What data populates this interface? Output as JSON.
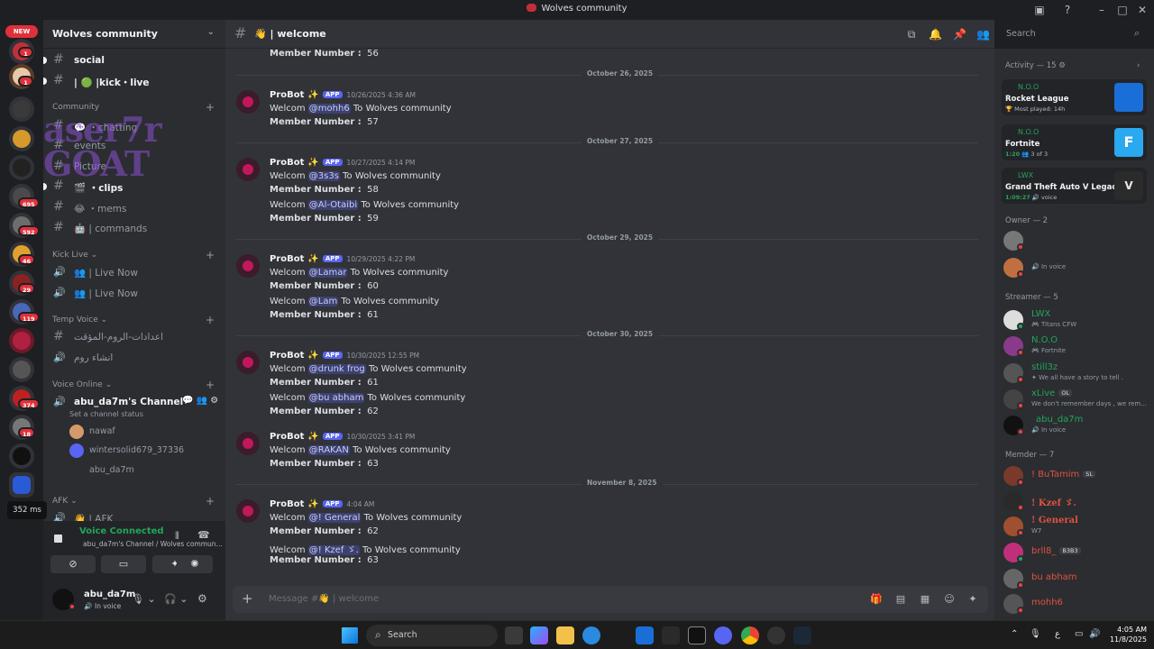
{
  "window": {
    "title": "Wolves community"
  },
  "servers": {
    "new_label": "NEW",
    "badges": [
      "1",
      "1",
      "695",
      "592",
      "46",
      "29",
      "119",
      "374",
      "18"
    ]
  },
  "guild": {
    "name": "Wolves community"
  },
  "channels": [
    {
      "label": "social",
      "unread": true
    },
    {
      "label": "| 🟢 |kick・live",
      "unread": true
    },
    {
      "label": "💬 ・chatting",
      "unread": false
    },
    {
      "label": "events",
      "unread": false
    },
    {
      "label": "Picture",
      "unread": false
    },
    {
      "label": "🎬 ・clips",
      "unread": true
    },
    {
      "label": "😂 ・mems",
      "unread": false
    },
    {
      "label": "🤖 | commands",
      "unread": false
    }
  ],
  "overlay_text": {
    "line1": "aser7r",
    "line2": "GOAT"
  },
  "categories": {
    "community": "Community",
    "kick_live": "Kick Live",
    "temp_voice": "Temp Voice",
    "voice_online": "Voice Online",
    "afk": "AFK"
  },
  "kick_live": [
    "👥 | Live Now",
    "👥 | Live Now"
  ],
  "temp_voice": [
    "اعدادات-الروم-المؤقت",
    "انشاء روم"
  ],
  "voice_channel": {
    "name": "abu_da7m's Channel",
    "status": "Set a channel status",
    "users": [
      "nawaf",
      "wintersolid679_37336",
      "abu_da7m"
    ]
  },
  "afk_channel": "👋 | AFK",
  "ping": "352 ms",
  "voice_panel": {
    "status": "Voice Connected",
    "location": "abu_da7m's Channel / Wolves commun..."
  },
  "user_panel": {
    "name": "abu_da7m",
    "status": "In voice"
  },
  "channel_header": {
    "name": "👋 | welcome",
    "search_placeholder": "Search"
  },
  "messages": {
    "top_line": {
      "label": "Member Number :",
      "value": "56"
    },
    "groups": [
      {
        "date": "October 26, 2025",
        "author": "ProBot",
        "badge": "APP",
        "time": "10/26/2025 4:36 AM",
        "entries": [
          {
            "mention": "@mohh6",
            "number": "57"
          }
        ]
      },
      {
        "date": "October 27, 2025",
        "author": "ProBot",
        "badge": "APP",
        "time": "10/27/2025 4:14 PM",
        "entries": [
          {
            "mention": "@3s3s",
            "number": "58"
          },
          {
            "mention": "@Al-Otaibi",
            "number": "59"
          }
        ]
      },
      {
        "date": "October 29, 2025",
        "author": "ProBot",
        "badge": "APP",
        "time": "10/29/2025 4:22 PM",
        "entries": [
          {
            "mention": "@Lamar",
            "number": "60"
          },
          {
            "mention": "@Lam",
            "number": "61"
          }
        ]
      },
      {
        "date": "October 30, 2025",
        "author": "ProBot",
        "badge": "APP",
        "time": "10/30/2025 12:55 PM",
        "entries": [
          {
            "mention": "@drunk frog",
            "number": "61"
          },
          {
            "mention": "@bu abham",
            "number": "62"
          }
        ]
      },
      {
        "date": "",
        "author": "ProBot",
        "badge": "APP",
        "time": "10/30/2025 3:41 PM",
        "entries": [
          {
            "mention": "@RAKAN",
            "number": "63"
          }
        ]
      },
      {
        "date": "November 8, 2025",
        "author": "ProBot",
        "badge": "APP",
        "time": "4:04 AM",
        "entries": [
          {
            "mention": "@! General",
            "number": "62"
          },
          {
            "mention": "@!  Kzef ゞ.",
            "number": "63"
          }
        ]
      }
    ],
    "welcome_word": "Welcom",
    "to_word": "To",
    "community": "Wolves community",
    "member_label": "Member Number :"
  },
  "composer": {
    "placeholder": "Message #👋 | welcome"
  },
  "activity": {
    "header": "Activity — 15",
    "cards": [
      {
        "user": "N.O.O",
        "game": "Rocket League",
        "detail": "Most played: 14h",
        "time": "",
        "extra": ""
      },
      {
        "user": "N.O.O",
        "game": "Fortnite",
        "detail": "",
        "time": "1:20",
        "extra": "3 of 3"
      },
      {
        "user": "LWX",
        "game": "Grand Theft Auto V Legacy",
        "detail": "",
        "time": "1:09:27",
        "extra": "voice"
      }
    ]
  },
  "member_groups": {
    "owner": "Owner — 2",
    "streamer": "Streamer — 5",
    "member": "Memder — 7",
    "owners": [
      {
        "name": "",
        "sub": ""
      },
      {
        "name": "",
        "sub": "In voice"
      }
    ],
    "streamers": [
      {
        "name": "LWX",
        "sub": "Titans CFW",
        "tag": ""
      },
      {
        "name": "N.O.O",
        "sub": "Fortnite",
        "tag": ""
      },
      {
        "name": "still3z",
        "sub": "We all have a story to tell .",
        "tag": ""
      },
      {
        "name": "xLive",
        "sub": "We don't remember days , we rem...",
        "tag": "OL"
      },
      {
        "name": "abu_da7m",
        "sub": "In voice",
        "tag": ""
      }
    ],
    "members": [
      {
        "name": "! BuTamim",
        "sub": "",
        "tag": "SL"
      },
      {
        "name": "! Kzef ゞ.",
        "sub": "",
        "tag": ""
      },
      {
        "name": "! General",
        "sub": "W7",
        "tag": ""
      },
      {
        "name": "brll8_",
        "sub": "",
        "tag": "B3B3"
      },
      {
        "name": "bu abham",
        "sub": "",
        "tag": ""
      },
      {
        "name": "mohh6",
        "sub": "",
        "tag": ""
      }
    ]
  },
  "taskbar": {
    "search": "Search",
    "lang": "ع",
    "time": "4:05 AM",
    "date": "11/8/2025"
  },
  "colors": {
    "accent": "#5865f2",
    "online": "#23a55a",
    "dnd": "#f23f43",
    "stream": "#23a55a",
    "member_name": "#e0523f"
  }
}
